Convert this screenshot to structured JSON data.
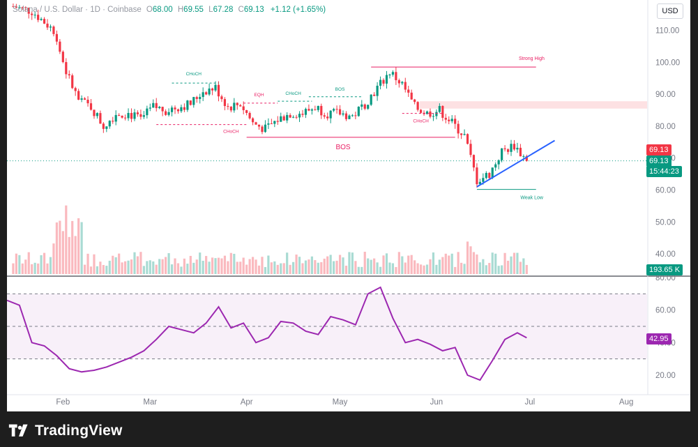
{
  "header": {
    "symbol": "Solana / U.S. Dollar · 1D · Coinbase",
    "open_label": "O",
    "open": "68.00",
    "high_label": "H",
    "high": "69.55",
    "low_label": "L",
    "low": "67.28",
    "close_label": "C",
    "close": "69.13",
    "change": "+1.12 (+1.65%)",
    "currency": "USD"
  },
  "price_tags": {
    "last_red": "69.13",
    "last_green": "69.13",
    "countdown": "15:44:23",
    "volume": "193.65 K",
    "rsi": "42.95"
  },
  "annotations": {
    "strong_high": "Strong High",
    "weak_low": "Weak Low",
    "bos_big": "BOS",
    "bos_small": "BOS",
    "choch_feb": "CHoCH",
    "choch_mar": "CHoCH",
    "choch_apr": "CHoCH",
    "eqh": "EQH",
    "choch_may": "CHoCH"
  },
  "branding": {
    "name": "TradingView"
  },
  "colors": {
    "up": "#089981",
    "down": "#f23645",
    "rsi_line": "#9c27b0",
    "trend": "#2962ff"
  },
  "chart_data": [
    {
      "type": "candlestick",
      "title": "Solana / U.S. Dollar · 1D · Coinbase",
      "x_tick_labels": [
        "Feb",
        "Mar",
        "Apr",
        "May",
        "Jun",
        "Jul",
        "Aug"
      ],
      "y_tick_labels": [
        "110.00",
        "100.00",
        "90.00",
        "80.00",
        "70.00",
        "60.00",
        "50.00",
        "40.00"
      ],
      "ylim": [
        36,
        115
      ],
      "levels": {
        "strong_high": 98.5,
        "weak_low": 60.2,
        "bos": 76.5,
        "supply_zone": [
          85.5,
          87.8
        ]
      },
      "approx_close_path": [
        [
          "2023-01-14",
          118
        ],
        [
          "2023-01-22",
          116
        ],
        [
          "2023-01-29",
          110
        ],
        [
          "2023-02-02",
          97
        ],
        [
          "2023-02-06",
          88
        ],
        [
          "2023-02-10",
          86
        ],
        [
          "2023-02-14",
          80
        ],
        [
          "2023-02-18",
          84
        ],
        [
          "2023-02-22",
          84
        ],
        [
          "2023-02-26",
          82
        ],
        [
          "2023-03-02",
          86
        ],
        [
          "2023-03-06",
          85
        ],
        [
          "2023-03-10",
          86
        ],
        [
          "2023-03-14",
          87
        ],
        [
          "2023-03-18",
          91
        ],
        [
          "2023-03-22",
          92
        ],
        [
          "2023-03-26",
          86
        ],
        [
          "2023-03-30",
          87
        ],
        [
          "2023-04-03",
          81
        ],
        [
          "2023-04-07",
          79
        ],
        [
          "2023-04-11",
          82
        ],
        [
          "2023-04-15",
          84
        ],
        [
          "2023-04-19",
          84
        ],
        [
          "2023-04-23",
          86
        ],
        [
          "2023-04-27",
          84
        ],
        [
          "2023-05-01",
          84
        ],
        [
          "2023-05-05",
          83
        ],
        [
          "2023-05-09",
          87
        ],
        [
          "2023-05-13",
          92
        ],
        [
          "2023-05-17",
          97
        ],
        [
          "2023-05-21",
          93
        ],
        [
          "2023-05-25",
          86
        ],
        [
          "2023-05-29",
          84
        ],
        [
          "2023-06-02",
          85
        ],
        [
          "2023-06-06",
          81
        ],
        [
          "2023-06-10",
          77
        ],
        [
          "2023-06-14",
          63
        ],
        [
          "2023-06-18",
          65
        ],
        [
          "2023-06-22",
          72
        ],
        [
          "2023-06-26",
          74
        ],
        [
          "2023-06-30",
          69.13
        ]
      ]
    },
    {
      "type": "bar",
      "title": "Volume",
      "last_value": "193.65 K"
    },
    {
      "type": "line",
      "title": "RSI",
      "y_tick_labels": [
        "80.00",
        "60.00",
        "40.00",
        "20.00"
      ],
      "ylim": [
        15,
        80
      ],
      "bands": [
        30,
        50,
        70
      ],
      "x": [
        "2023-01-14",
        "2023-01-18",
        "2023-01-22",
        "2023-01-26",
        "2023-01-30",
        "2023-02-03",
        "2023-02-07",
        "2023-02-11",
        "2023-02-15",
        "2023-02-19",
        "2023-02-23",
        "2023-02-27",
        "2023-03-03",
        "2023-03-07",
        "2023-03-11",
        "2023-03-15",
        "2023-03-19",
        "2023-03-23",
        "2023-03-27",
        "2023-03-31",
        "2023-04-04",
        "2023-04-08",
        "2023-04-12",
        "2023-04-16",
        "2023-04-20",
        "2023-04-24",
        "2023-04-28",
        "2023-05-02",
        "2023-05-06",
        "2023-05-10",
        "2023-05-14",
        "2023-05-18",
        "2023-05-22",
        "2023-05-26",
        "2023-05-30",
        "2023-06-03",
        "2023-06-07",
        "2023-06-11",
        "2023-06-15",
        "2023-06-19",
        "2023-06-23",
        "2023-06-27",
        "2023-06-30"
      ],
      "values": [
        66,
        63,
        40,
        38,
        32,
        24,
        22,
        23,
        25,
        28,
        31,
        35,
        42,
        50,
        48,
        46,
        52,
        62,
        49,
        52,
        40,
        43,
        53,
        52,
        47,
        45,
        56,
        54,
        51,
        70,
        74,
        55,
        40,
        42,
        39,
        35,
        37,
        20,
        17,
        29,
        42,
        46,
        42.95
      ]
    }
  ]
}
